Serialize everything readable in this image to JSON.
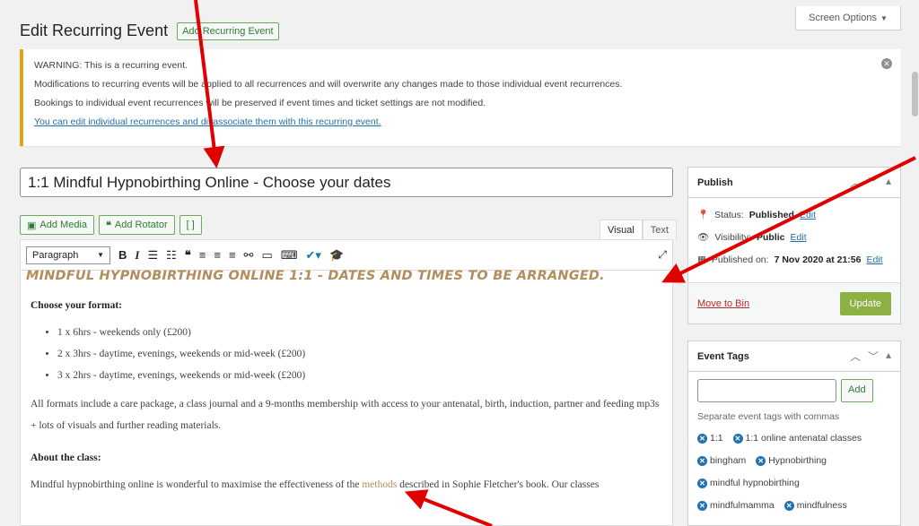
{
  "screen_options": {
    "label": "Screen Options",
    "chevron": "▼"
  },
  "header": {
    "title": "Edit Recurring Event",
    "add_button": "Add Recurring Event"
  },
  "notice": {
    "line1": "WARNING: This is a recurring event.",
    "line2": "Modifications to recurring events will be applied to all recurrences and will overwrite any changes made to those individual event recurrences.",
    "line3": "Bookings to individual event recurrences will be preserved if event times and ticket settings are not modified.",
    "link": "You can edit individual recurrences and disassociate them with this recurring event."
  },
  "title_input": {
    "value": "1:1 Mindful Hypnobirthing Online - Choose your dates"
  },
  "media": {
    "add_media": "Add Media",
    "add_rotator": "Add Rotator",
    "shortcode": "[ ]"
  },
  "tabs": {
    "visual": "Visual",
    "text": "Text"
  },
  "toolbar": {
    "format": "Paragraph"
  },
  "content": {
    "heading": "MINDFUL HYPNOBIRTHING ONLINE 1:1 - DATES AND TIMES TO BE ARRANGED.",
    "format_heading": "Choose your format:",
    "formats": [
      "1 x 6hrs - weekends only (£200)",
      "2 x 3hrs - daytime, evenings, weekends or mid-week (£200)",
      "3 x 2hrs - daytime, evenings, weekends or mid-week (£200)"
    ],
    "para1": "All formats include a care package, a class journal and a 9-months membership with access to your antenatal, birth, induction, partner and feeding mp3s + lots of visuals and further reading materials.",
    "about_heading": "About the class:",
    "para2_start": "Mindful hypnobirthing online is wonderful to maximise the effectiveness of the ",
    "para2_highlight": "methods",
    "para2_end": " described in Sophie Fletcher's book. Our classes"
  },
  "publish": {
    "title": "Publish",
    "status_label": "Status:",
    "status_value": "Published",
    "status_edit": "Edit",
    "visibility_label": "Visibility:",
    "visibility_value": "Public",
    "visibility_edit": "Edit",
    "published_label": "Published on:",
    "published_value": "7 Nov 2020 at 21:56",
    "published_edit": "Edit",
    "move_to_bin": "Move to Bin",
    "update": "Update"
  },
  "event_tags": {
    "title": "Event Tags",
    "add": "Add",
    "help": "Separate event tags with commas",
    "tags": [
      "1:1",
      "1:1 online antenatal classes",
      "bingham",
      "Hypnobirthing",
      "mindful hypnobirthing",
      "mindfulmamma",
      "mindfulness"
    ]
  },
  "colors": {
    "accent": "#2271b1",
    "warning": "#dba617",
    "heading": "#b38e5d",
    "update": "#8cb043",
    "annotation": "#e00000"
  }
}
